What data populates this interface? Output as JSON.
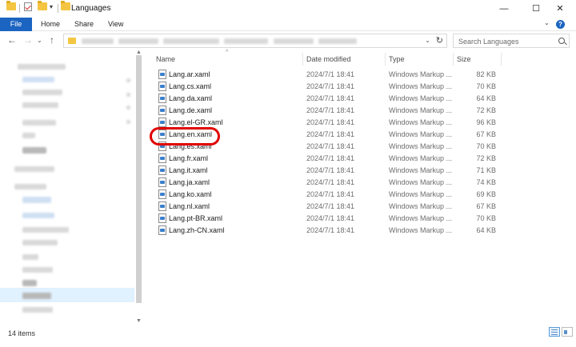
{
  "window": {
    "title": "Languages",
    "minimize": "—",
    "maximize": "☐",
    "close": "✕"
  },
  "ribbon": {
    "tabs": [
      "File",
      "Home",
      "Share",
      "View"
    ],
    "expand": "⌄",
    "help": "?"
  },
  "nav": {
    "back": "←",
    "forward": "→",
    "recent": "⌄",
    "up": "↑",
    "address_dropdown": "⌄",
    "refresh": "↻"
  },
  "search": {
    "placeholder": "Search Languages"
  },
  "columns": {
    "name": "Name",
    "date": "Date modified",
    "type": "Type",
    "size": "Size",
    "sort": "^"
  },
  "files": [
    {
      "name": "Lang.ar.xaml",
      "date": "2024/7/1 18:41",
      "type": "Windows Markup ...",
      "size": "82 KB"
    },
    {
      "name": "Lang.cs.xaml",
      "date": "2024/7/1 18:41",
      "type": "Windows Markup ...",
      "size": "70 KB"
    },
    {
      "name": "Lang.da.xaml",
      "date": "2024/7/1 18:41",
      "type": "Windows Markup ...",
      "size": "64 KB"
    },
    {
      "name": "Lang.de.xaml",
      "date": "2024/7/1 18:41",
      "type": "Windows Markup ...",
      "size": "72 KB"
    },
    {
      "name": "Lang.el-GR.xaml",
      "date": "2024/7/1 18:41",
      "type": "Windows Markup ...",
      "size": "96 KB"
    },
    {
      "name": "Lang.en.xaml",
      "date": "2024/7/1 18:41",
      "type": "Windows Markup ...",
      "size": "67 KB"
    },
    {
      "name": "Lang.es.xaml",
      "date": "2024/7/1 18:41",
      "type": "Windows Markup ...",
      "size": "70 KB"
    },
    {
      "name": "Lang.fr.xaml",
      "date": "2024/7/1 18:41",
      "type": "Windows Markup ...",
      "size": "72 KB"
    },
    {
      "name": "Lang.it.xaml",
      "date": "2024/7/1 18:41",
      "type": "Windows Markup ...",
      "size": "71 KB"
    },
    {
      "name": "Lang.ja.xaml",
      "date": "2024/7/1 18:41",
      "type": "Windows Markup ...",
      "size": "74 KB"
    },
    {
      "name": "Lang.ko.xaml",
      "date": "2024/7/1 18:41",
      "type": "Windows Markup ...",
      "size": "69 KB"
    },
    {
      "name": "Lang.nl.xaml",
      "date": "2024/7/1 18:41",
      "type": "Windows Markup ...",
      "size": "67 KB"
    },
    {
      "name": "Lang.pt-BR.xaml",
      "date": "2024/7/1 18:41",
      "type": "Windows Markup ...",
      "size": "70 KB"
    },
    {
      "name": "Lang.zh-CN.xaml",
      "date": "2024/7/1 18:41",
      "type": "Windows Markup ...",
      "size": "64 KB"
    }
  ],
  "status": {
    "count": "14 items"
  },
  "colors": {
    "accent": "#1b64c1",
    "highlight_ring": "#e00000",
    "selection": "#cce8ff"
  },
  "icons": {
    "folder": "folder-icon",
    "properties": "properties-checkmark-icon",
    "file": "xaml-file-icon",
    "search": "search-icon",
    "refresh": "refresh-icon",
    "help": "help-icon"
  }
}
